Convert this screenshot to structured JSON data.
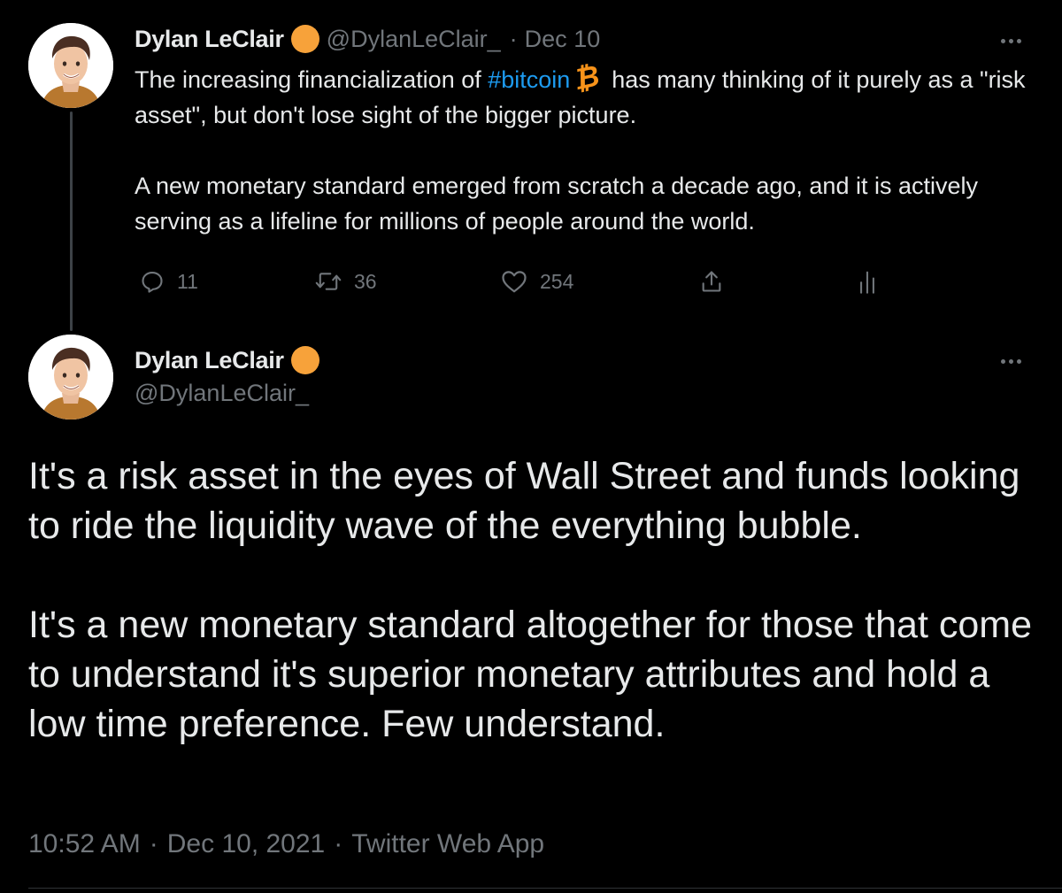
{
  "colors": {
    "background": "#000000",
    "text": "#e7e9ea",
    "muted": "#71767b",
    "link": "#1d9bf0",
    "badge": "#f7a23a",
    "bitcoin": "#f7931a"
  },
  "quoted_tweet": {
    "display_name": "Dylan LeClair",
    "handle": "@DylanLeClair_",
    "separator": "·",
    "date": "Dec 10",
    "verified_icon": "verified-badge-icon",
    "text": {
      "line1_before": "The increasing financialization of ",
      "hashtag": "#bitcoin",
      "emoji": "bitcoin-icon",
      "emoji_glyph": "₿",
      "line1_after": "has many thinking of it purely as a \"risk asset\", but don't lose sight of the bigger picture.",
      "paragraph2": "A new monetary standard emerged from scratch a decade ago, and it is actively serving as a lifeline for millions of people around the world."
    },
    "actions": {
      "reply_count": "11",
      "retweet_count": "36",
      "like_count": "254"
    }
  },
  "main_tweet": {
    "display_name": "Dylan LeClair",
    "handle": "@DylanLeClair_",
    "verified_icon": "verified-badge-icon",
    "paragraph1": "It's a risk asset in the eyes of Wall Street and funds looking to ride the liquidity wave of the everything bubble.",
    "paragraph2": "It's a new monetary standard altogether for those that come to understand it's superior monetary attributes and hold a low time preference. Few understand.",
    "time": "10:52 AM",
    "separator": "·",
    "date": "Dec 10, 2021",
    "source": "Twitter Web App"
  }
}
